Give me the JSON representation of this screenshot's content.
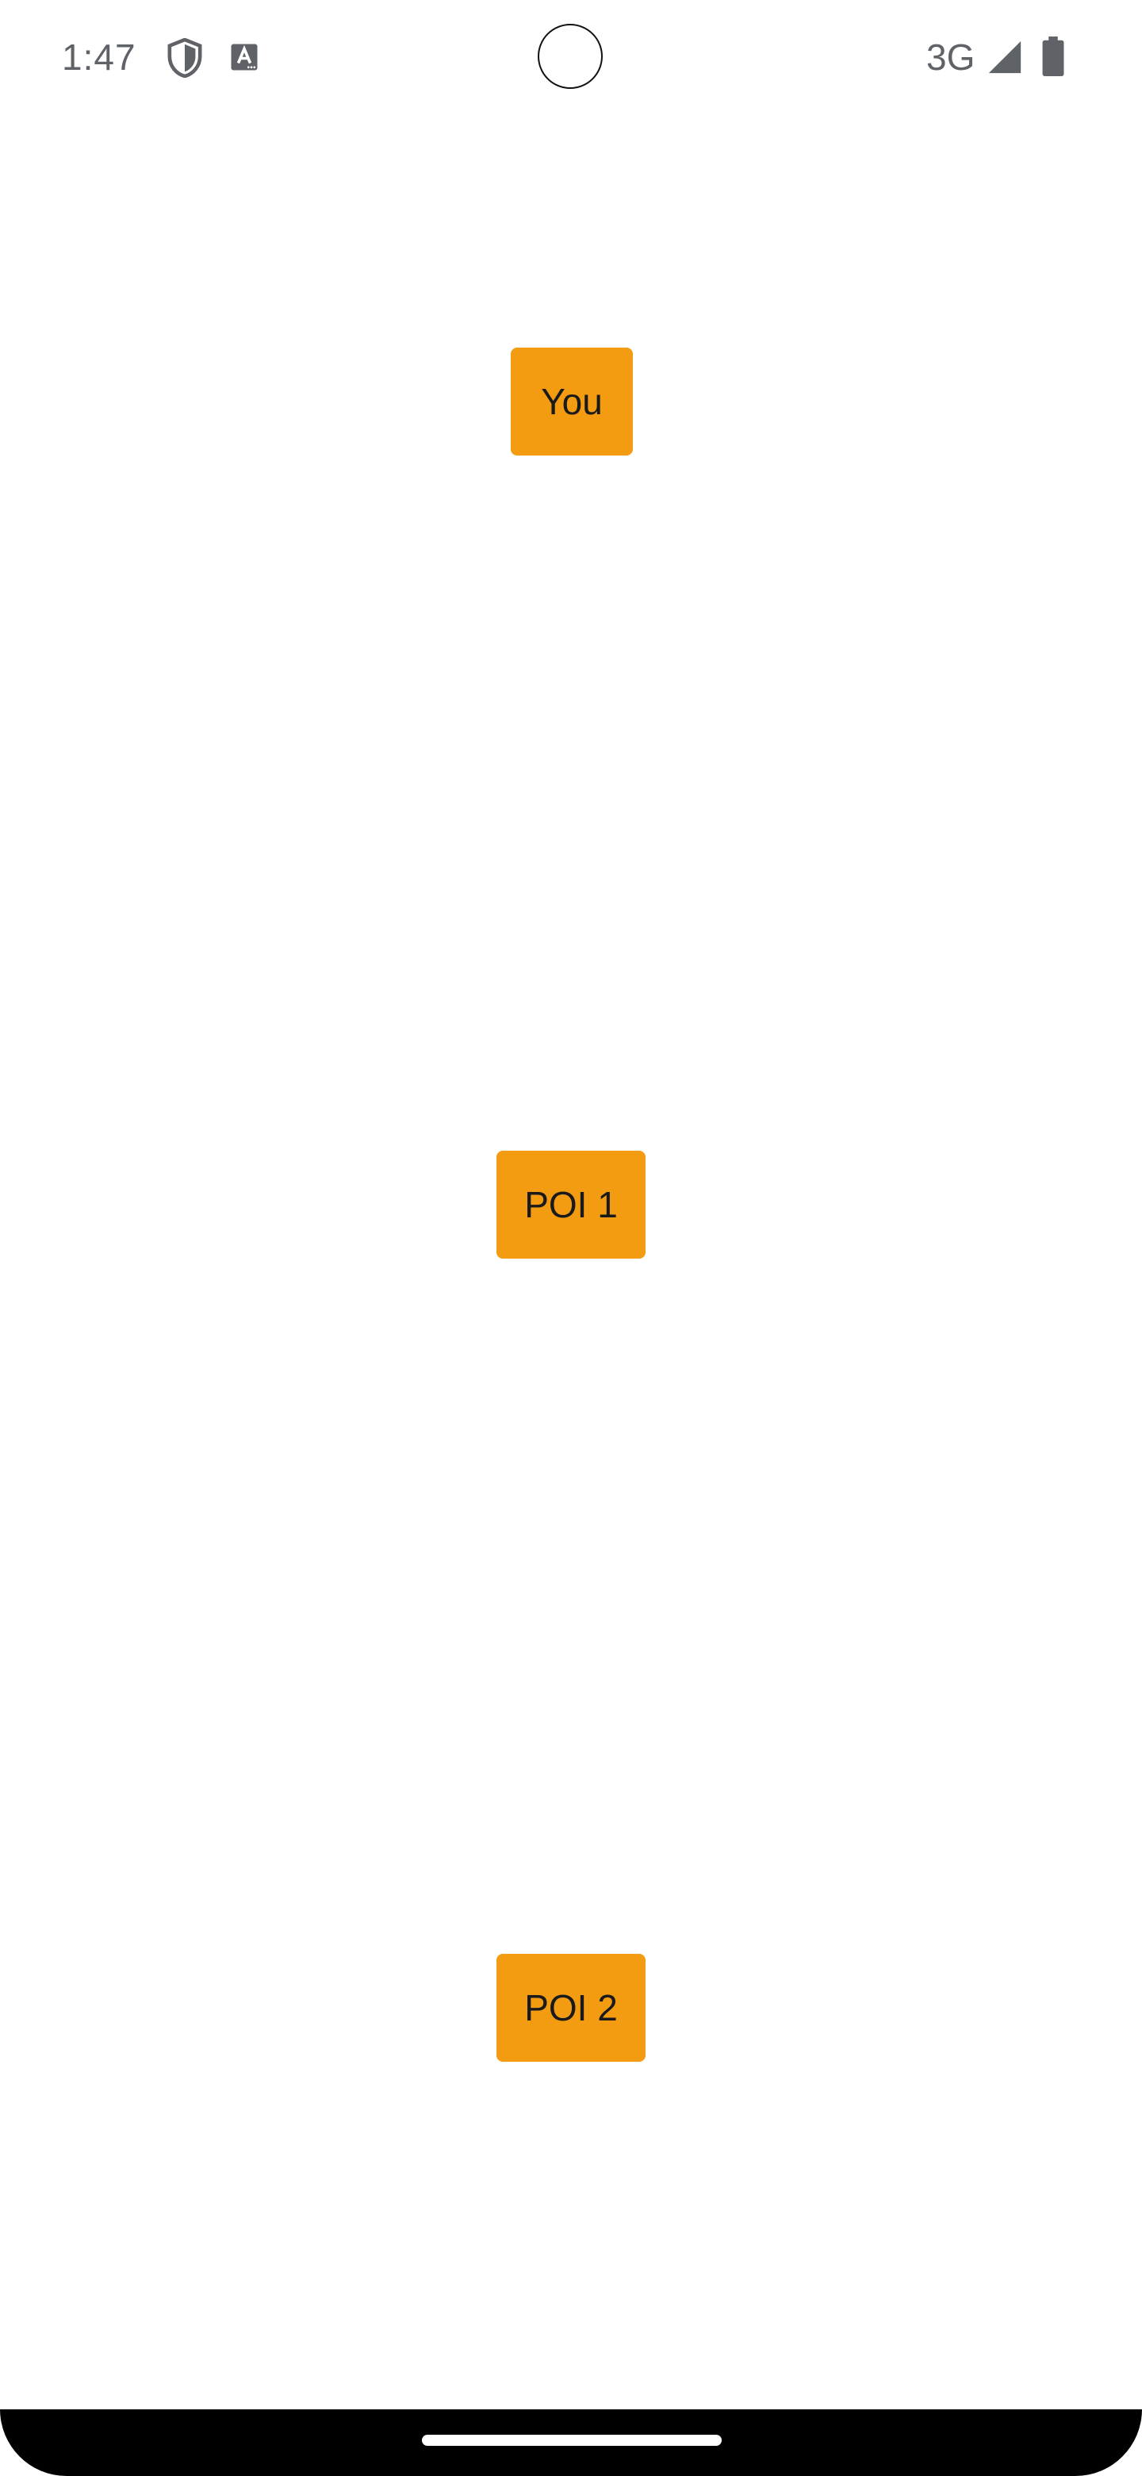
{
  "status_bar": {
    "time": "1:47",
    "network": "3G",
    "icons": [
      "shield-icon",
      "text-a-icon",
      "signal-icon",
      "battery-icon"
    ]
  },
  "markers": [
    {
      "label": "You"
    },
    {
      "label": "POI 1"
    },
    {
      "label": "POI 2"
    }
  ],
  "colors": {
    "marker_bg": "#f39c12",
    "status_icon": "#5f6368",
    "nav_bar": "#000000"
  }
}
